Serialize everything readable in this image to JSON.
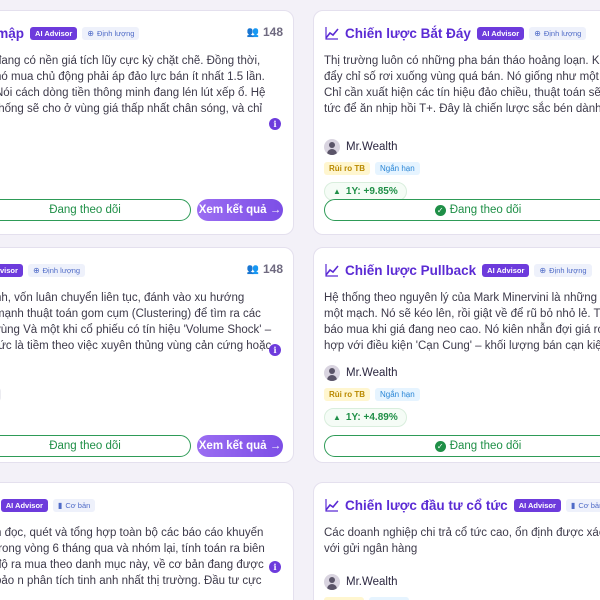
{
  "cards": [
    {
      "title": "á mập",
      "ai_badge": "AI Advisor",
      "type_icon": "crosshair-icon",
      "type_label": "Định lượng",
      "followers": "148",
      "desc": "đang có nền giá tích lũy cực kỳ chặt chẽ. Đồng thời, nó mua chủ động phải áp đảo lực bán ít nhất 1.5 lần. Nói cách dòng tiền thông minh đang lén lút xếp ổ. Hệ thống sẽ cho ở vùng giá thấp nhất chân sóng, và chỉ chờ giờ đông th...",
      "follow_label": "Đang theo dõi",
      "view_label": "Xem kết quả →"
    },
    {
      "title": "Chiến lược Bắt Đáy",
      "ai_badge": "AI Advisor",
      "type_icon": "crosshair-icon",
      "type_label": "Định lượng",
      "desc": "Thị trường luôn có những pha bán tháo hoảng loạn. Khi c đẩy chỉ số rơi xuống vùng quá bán. Nó giống như một sợ Chỉ cần xuất hiện các tín hiệu đảo chiều, thuật toán sẽ b lập tức để ăn nhịp hồi T+. Đây là chiến lược sắc bén dành",
      "author": "Mr.Wealth",
      "risk_tag": "Rủi ro TB",
      "term_tag": "Ngắn hạn",
      "perf": "1Y: +9.85%",
      "follow_label": "Đang theo dõi"
    },
    {
      "title": "",
      "ai_badge": "Advisor",
      "type_icon": "crosshair-icon",
      "type_label": "Định lượng",
      "followers": "148",
      "desc": "nh, vốn luân chuyển liên tục, đánh vào xu hướng mạnh thuật toán gom cụm (Clustering) để tìm ra các vùng Và một khi cổ phiếu có tín hiệu 'Volume Shock' – tức là tiềm theo việc xuyên thủng vùng cản cứng hoặc vượt đỉn...",
      "follow_label": "Đang theo dõi",
      "view_label": "Xem kết quả →"
    },
    {
      "title": "Chiến lược Pullback",
      "ai_badge": "AI Advisor",
      "type_icon": "crosshair-icon",
      "type_label": "Định lượng",
      "desc": "Hệ thống theo nguyên lý của Mark Minervini là những siêu một mạch. Nó sẽ kéo lên, rồi giật về để rũ bỏ nhỏ lẻ. Thuật báo mua khi giá đang neo cao. Nó kiên nhẫn đợi giá rơi v hợp với điều kiện 'Cạn Cung' – khối lượng bán cạn kiệt. Đ",
      "author": "Mr.Wealth",
      "risk_tag": "Rủi ro TB",
      "term_tag": "Ngắn hạn",
      "perf": "1Y: +4.89%",
      "follow_label": "Đang theo dõi"
    },
    {
      "title": "K",
      "ai_badge": "AI Advisor",
      "type_icon": "bar-chart-icon",
      "type_label": "Cơ bản",
      "desc": "n đọc, quét và tổng hợp toàn bộ các báo cáo khuyến trong vòng 6 tháng qua và nhóm lại, tính toán ra biên độ ra mua theo danh mục này, về cơ bản đang được bảo n phân tích tinh anh nhất thị trường. Đầu tư cực kỳ..."
    },
    {
      "title": "Chiến lược đầu tư cổ tức",
      "ai_badge": "AI Advisor",
      "type_icon": "bar-chart-icon",
      "type_label": "Cơ bản",
      "desc": "Các doanh nghiệp chi trả cổ tức cao, ổn định được xác c so với gửi ngân hàng",
      "author": "Mr.Wealth"
    }
  ],
  "colors": {
    "accent": "#5b2bd4",
    "ai_badge": "#6d3bdc",
    "follow_green": "#1f8f47",
    "view_gradient_start": "#9b6df2",
    "view_gradient_end": "#7c4ee6",
    "risk_bg": "#fff6cf",
    "risk_fg": "#b98900",
    "term_bg": "#e6f4ff",
    "term_fg": "#2a86d6"
  }
}
